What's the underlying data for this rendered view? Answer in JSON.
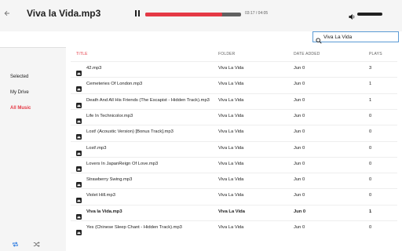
{
  "header": {
    "back_icon": "arrow-left-icon",
    "title": "Viva la Vida.mp3",
    "time": "03:17 / 04:05",
    "progress": 0.8,
    "volume": 1.0,
    "accent": "#e53945"
  },
  "search": {
    "value": "Viva La Vida",
    "placeholder": ""
  },
  "sidebar": {
    "items": [
      {
        "label": "Selected",
        "active": false
      },
      {
        "label": "My Drive",
        "active": false
      },
      {
        "label": "All Music",
        "active": true
      }
    ],
    "bottom_icons": [
      "repeat-icon",
      "shuffle-icon"
    ]
  },
  "table": {
    "headers": {
      "title": "TITLE",
      "folder": "FOLDER",
      "date": "DATE ADDED",
      "plays": "PLAYS"
    },
    "rows": [
      {
        "title": "42.mp3",
        "folder": "Viva La Vida",
        "date": "Jun 0",
        "plays": "3",
        "playing": false
      },
      {
        "title": "Cemeteries Of London.mp3",
        "folder": "Viva La Vida",
        "date": "Jun 0",
        "plays": "1",
        "playing": false
      },
      {
        "title": "Death And All His Friends (The Escapist - Hidden Track).mp3",
        "folder": "Viva La Vida",
        "date": "Jun 0",
        "plays": "1",
        "playing": false
      },
      {
        "title": "Life In Technicolor.mp3",
        "folder": "Viva La Vida",
        "date": "Jun 0",
        "plays": "0",
        "playing": false
      },
      {
        "title": "Lost! (Acoustic Version) [Bonus Track].mp3",
        "folder": "Viva La Vida",
        "date": "Jun 0",
        "plays": "0",
        "playing": false
      },
      {
        "title": "Lost!.mp3",
        "folder": "Viva La Vida",
        "date": "Jun 0",
        "plays": "0",
        "playing": false
      },
      {
        "title": "Lovers In JapanReign Of Love.mp3",
        "folder": "Viva La Vida",
        "date": "Jun 0",
        "plays": "0",
        "playing": false
      },
      {
        "title": "Strawberry Swing.mp3",
        "folder": "Viva La Vida",
        "date": "Jun 0",
        "plays": "0",
        "playing": false
      },
      {
        "title": "Violet Hill.mp3",
        "folder": "Viva La Vida",
        "date": "Jun 0",
        "plays": "0",
        "playing": false
      },
      {
        "title": "Viva la Vida.mp3",
        "folder": "Viva La Vida",
        "date": "Jun 0",
        "plays": "1",
        "playing": true
      },
      {
        "title": "Yes (Chinese Sleep Chant - Hidden Track).mp3",
        "folder": "Viva La Vida",
        "date": "Jun 0",
        "plays": "0",
        "playing": false
      }
    ]
  }
}
